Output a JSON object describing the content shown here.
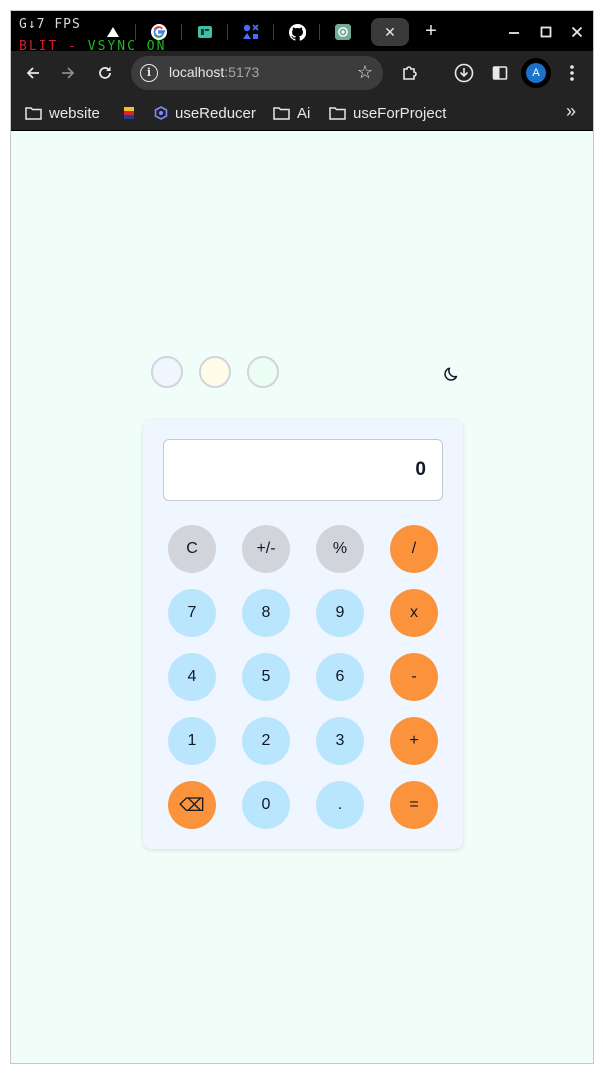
{
  "overlay": {
    "line1_prefix": "G↓7",
    "fps_text": "FPS",
    "line2_red": "BLIT",
    "line2_sep": " - ",
    "line2_green": "VSYNC ON"
  },
  "tabs": [
    {
      "icon": "triangle-logo-icon"
    },
    {
      "icon": "google-icon"
    },
    {
      "icon": "panel-app-icon"
    },
    {
      "icon": "shapes-app-icon"
    },
    {
      "icon": "github-icon"
    },
    {
      "icon": "openai-icon"
    },
    {
      "icon": "active-tab",
      "close_label": "✕"
    }
  ],
  "toolbar": {
    "url_host": "localhost",
    "url_port": ":5173",
    "avatar_letter": "A"
  },
  "bookmarks": [
    {
      "label": "website",
      "icon": "folder-icon"
    },
    {
      "label": "",
      "icon": "favicon-tricolor-icon"
    },
    {
      "label": "useReducer",
      "icon": "hexagon-icon"
    },
    {
      "label": "Ai",
      "icon": "folder-icon"
    },
    {
      "label": "useForProject",
      "icon": "folder-icon"
    }
  ],
  "theme": {
    "swatches": [
      "#eff6ff",
      "#fefce8",
      "#ecfdf5"
    ],
    "page_bg": "#f0fdf9",
    "mode_toggle_icon": "moon-icon"
  },
  "calculator": {
    "display_value": "0",
    "keys": [
      {
        "label": "C",
        "style": "gray"
      },
      {
        "label": "+/-",
        "style": "gray"
      },
      {
        "label": "%",
        "style": "gray"
      },
      {
        "label": "/",
        "style": "orange"
      },
      {
        "label": "7",
        "style": "blue"
      },
      {
        "label": "8",
        "style": "blue"
      },
      {
        "label": "9",
        "style": "blue"
      },
      {
        "label": "x",
        "style": "orange"
      },
      {
        "label": "4",
        "style": "blue"
      },
      {
        "label": "5",
        "style": "blue"
      },
      {
        "label": "6",
        "style": "blue"
      },
      {
        "label": "-",
        "style": "orange"
      },
      {
        "label": "1",
        "style": "blue"
      },
      {
        "label": "2",
        "style": "blue"
      },
      {
        "label": "3",
        "style": "blue"
      },
      {
        "label": "+",
        "style": "orange"
      },
      {
        "label": "⌫",
        "style": "orange"
      },
      {
        "label": "0",
        "style": "blue"
      },
      {
        "label": ".",
        "style": "blue"
      },
      {
        "label": "=",
        "style": "orange"
      }
    ]
  }
}
